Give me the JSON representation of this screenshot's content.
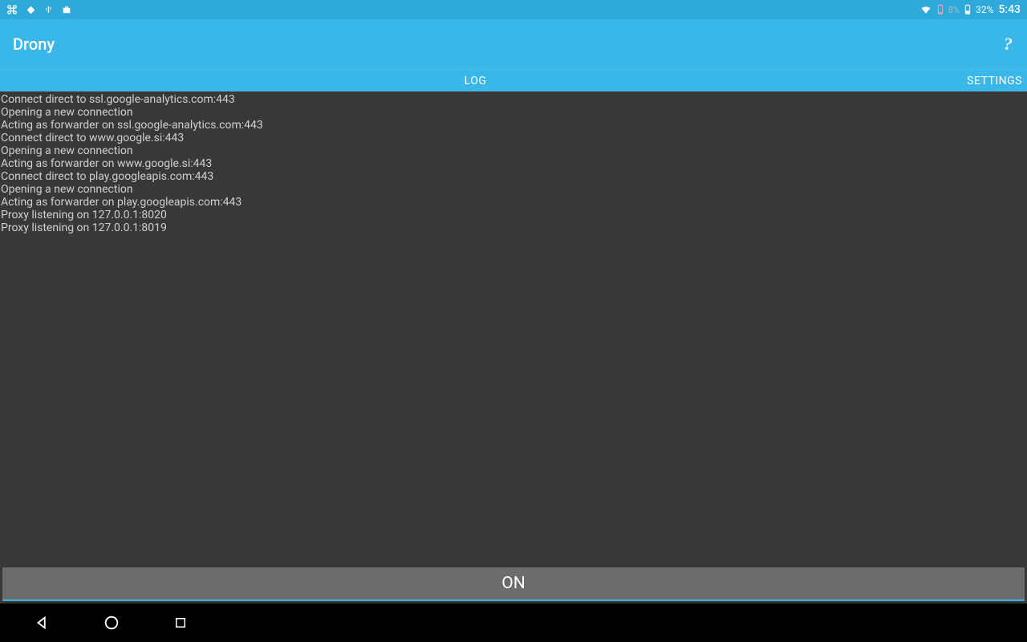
{
  "status_bar": {
    "battery1_pct": "8%",
    "battery2_pct": "32%",
    "clock": "5:43"
  },
  "app": {
    "title": "Drony"
  },
  "tabs": {
    "log": "LOG",
    "settings": "SETTINGS"
  },
  "log_lines": [
    "Connect direct to ssl.google-analytics.com:443",
    "Opening a new connection",
    "Acting as forwarder on ssl.google-analytics.com:443",
    "Connect direct to www.google.si:443",
    "Opening a new connection",
    "Acting as forwarder on www.google.si:443",
    "Connect direct to play.googleapis.com:443",
    "Opening a new connection",
    "Acting as forwarder on play.googleapis.com:443",
    "Proxy listening on 127.0.0.1:8020",
    "Proxy listening on 127.0.0.1:8019"
  ],
  "on_button": "ON"
}
